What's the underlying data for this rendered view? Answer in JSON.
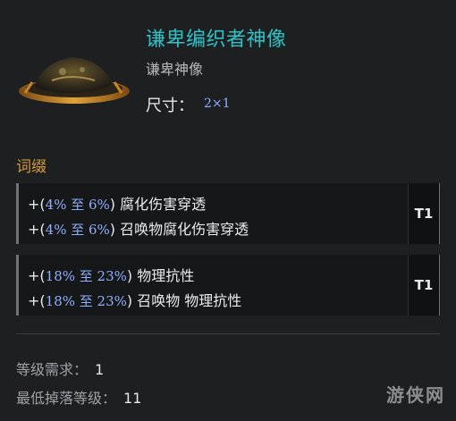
{
  "item": {
    "title": "谦卑编织者神像",
    "subtitle": "谦卑神像",
    "size_label": "尺寸：",
    "size_value": "2×1",
    "icon": "idol-icon"
  },
  "affixes": {
    "section_title": "词缀",
    "groups": [
      {
        "lines": [
          {
            "prefix": "+(",
            "range": "4% 至 6%",
            "suffix": ") ",
            "text": "腐化伤害穿透"
          },
          {
            "prefix": "+(",
            "range": "4% 至 6%",
            "suffix": ") ",
            "text": "召唤物腐化伤害穿透"
          }
        ],
        "tier": "T1"
      },
      {
        "lines": [
          {
            "prefix": "+(",
            "range": "18% 至 23%",
            "suffix": ") ",
            "text": "物理抗性"
          },
          {
            "prefix": "+(",
            "range": "18% 至 23%",
            "suffix": ") ",
            "text": "召唤物 物理抗性"
          }
        ],
        "tier": "T1"
      }
    ]
  },
  "requirements": {
    "level_label": "等级需求：",
    "level_value": "1",
    "drop_label": "最低掉落等级：",
    "drop_value": "11"
  },
  "watermark": "游侠网",
  "colors": {
    "title": "#2ec4c7",
    "section": "#d39b3a",
    "range": "#8fb0ff",
    "background": "#1d1f21"
  }
}
